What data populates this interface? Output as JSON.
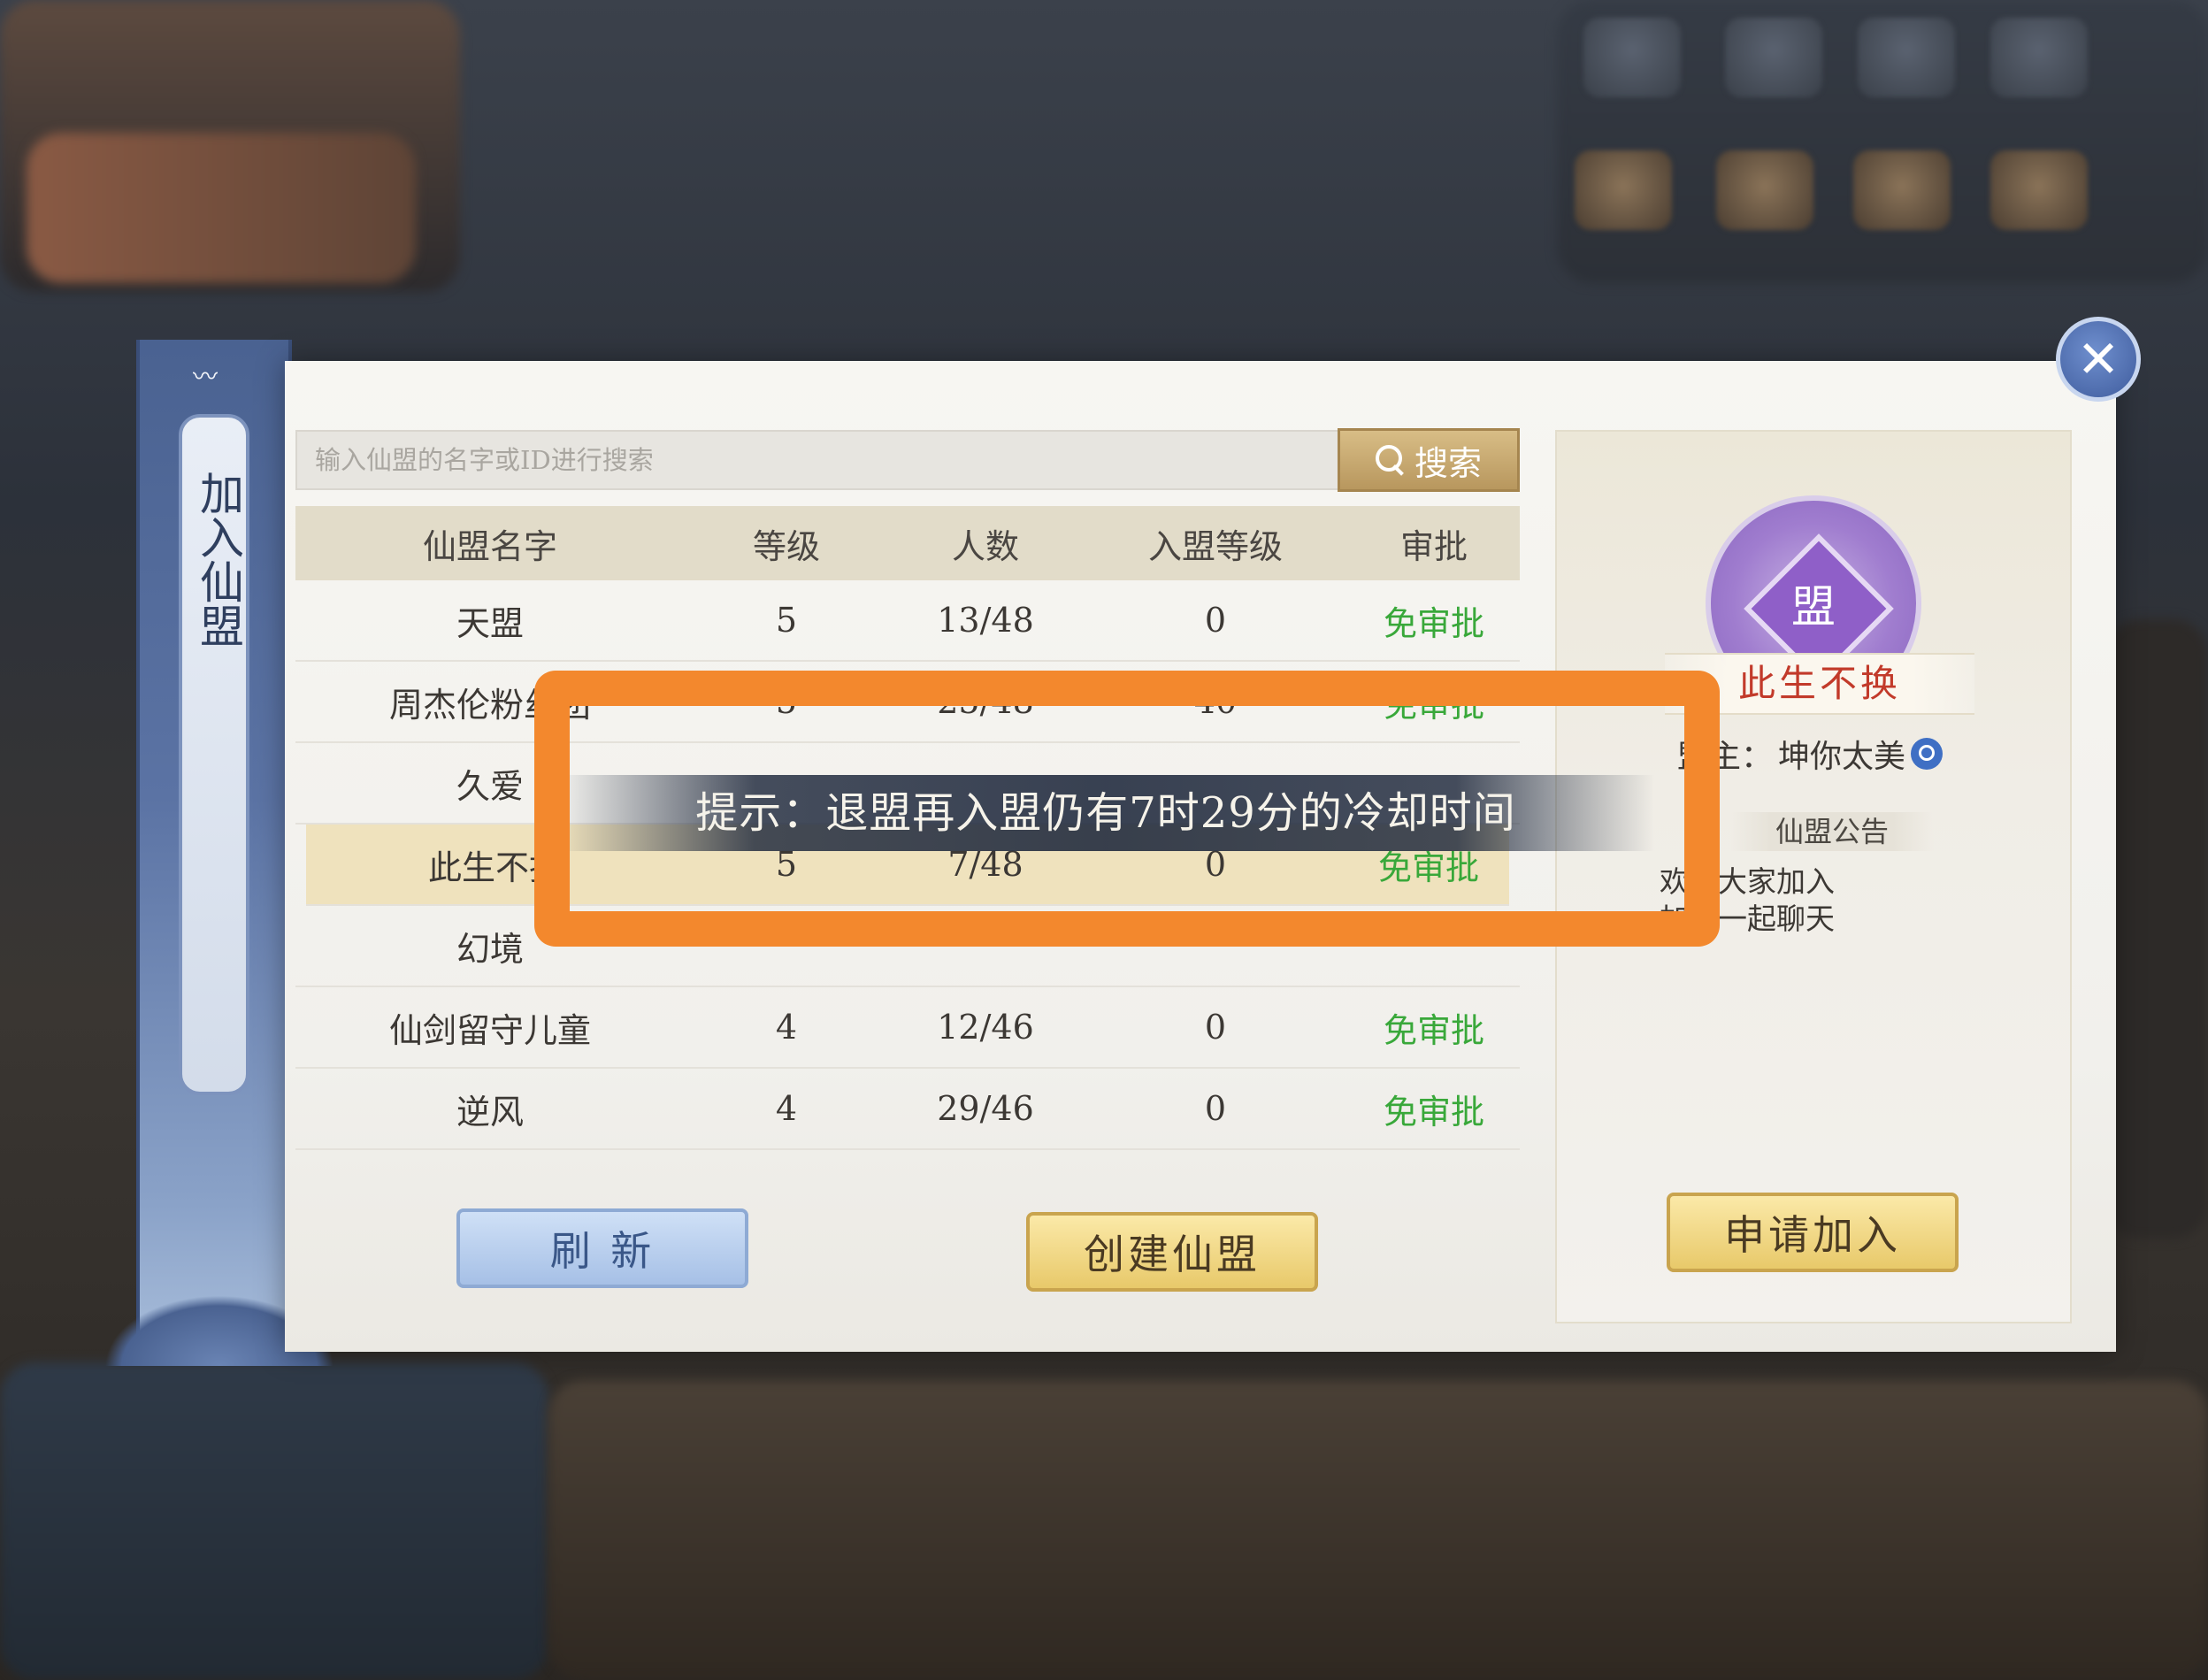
{
  "sidebar": {
    "title": "加入仙盟"
  },
  "search": {
    "placeholder": "输入仙盟的名字或ID进行搜索",
    "button_label": "搜索"
  },
  "table": {
    "headers": [
      "仙盟名字",
      "等级",
      "人数",
      "入盟等级",
      "审批"
    ],
    "rows": [
      {
        "name": "天盟",
        "level": "5",
        "members": "13/48",
        "join_level": "0",
        "approval": "免审批"
      },
      {
        "name": "周杰伦粉丝团",
        "level": "5",
        "members": "25/48",
        "join_level": "40",
        "approval": "免审批"
      },
      {
        "name": "久爱",
        "level": "",
        "members": "",
        "join_level": "",
        "approval": ""
      },
      {
        "name": "此生不换",
        "level": "5",
        "members": "7/48",
        "join_level": "0",
        "approval": "免审批"
      },
      {
        "name": "幻境",
        "level": "",
        "members": "",
        "join_level": "",
        "approval": ""
      },
      {
        "name": "仙剑留守儿童",
        "level": "4",
        "members": "12/46",
        "join_level": "0",
        "approval": "免审批"
      },
      {
        "name": "逆风",
        "level": "4",
        "members": "29/46",
        "join_level": "0",
        "approval": "免审批"
      }
    ]
  },
  "buttons": {
    "refresh": "刷 新",
    "create": "创建仙盟",
    "apply": "申请加入"
  },
  "guild_detail": {
    "emblem_glyph": "盟",
    "name": "此生不换",
    "leader_label": "盟主：",
    "leader_name": "坤你太美",
    "notice_title": "仙盟公告",
    "notice_line1": "欢迎大家加入",
    "notice_line2": "加盟一起聊天"
  },
  "toast": {
    "text": "提示：退盟再入盟仍有7时29分的冷却时间"
  },
  "colors": {
    "approval_green": "#39a83a",
    "highlight_orange": "#f3882d",
    "guild_name_red": "#c23a2a"
  },
  "icons": {
    "close": "close-icon",
    "search": "search-icon",
    "leader_lookup": "magnifier-icon"
  }
}
